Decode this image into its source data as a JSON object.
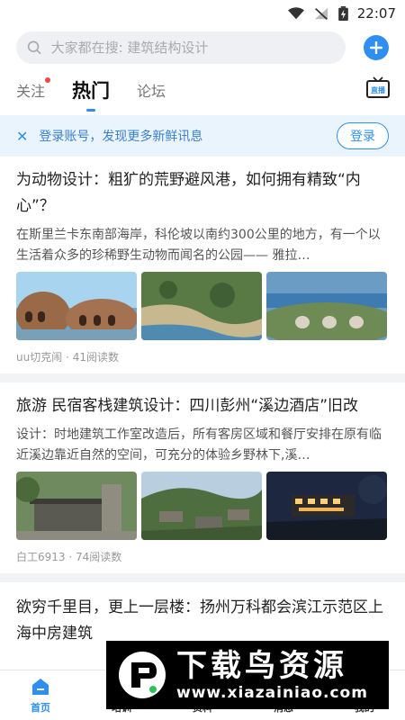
{
  "status": {
    "time": "22:07"
  },
  "search": {
    "placeholder": "大家都在搜: 建筑结构设计"
  },
  "tabs": [
    {
      "label": "关注"
    },
    {
      "label": "热门"
    },
    {
      "label": "论坛"
    }
  ],
  "live": {
    "label": "直播"
  },
  "login_bar": {
    "message": "登录账号，发现更多新鲜讯息",
    "button": "登录"
  },
  "articles": [
    {
      "title": "为动物设计：粗犷的荒野避风港，如何拥有精致“内心”？",
      "summary": "在斯里兰卡东南部海岸，科伦坡以南约300公里的地方，有一个以生活着众多的珍稀野生动物而闻名的公园—— 雅拉…",
      "author": "uu切克闹",
      "reads": "41阅读数"
    },
    {
      "title": "旅游 民宿客栈建筑设计：四川彭州“溪边酒店”旧改",
      "summary": "设计：时地建筑工作室改造后，所有客房区域和餐厅安排在原有临近溪边靠近自然的空间，可充分的体验乡野林下,溪…",
      "author": "白工6913",
      "reads": "74阅读数"
    },
    {
      "title": "欲穷千里目，更上一层楼：扬州万科都会滨江示范区上海中房建筑"
    }
  ],
  "meta_separator": "·",
  "bottom_nav": [
    {
      "label": "首页",
      "icon": "home-icon"
    },
    {
      "label": "培训",
      "icon": "training-icon"
    },
    {
      "label": "资料",
      "icon": "materials-icon"
    },
    {
      "label": "消息",
      "icon": "message-icon"
    },
    {
      "label": "我的",
      "icon": "profile-icon"
    }
  ],
  "watermark": {
    "title": "下载鸟资源",
    "url": "www.xiazainiao.com"
  },
  "colors": {
    "accent": "#2f8ff0",
    "login_bar_bg": "#eaf4fd",
    "notification_dot": "#f04848"
  }
}
